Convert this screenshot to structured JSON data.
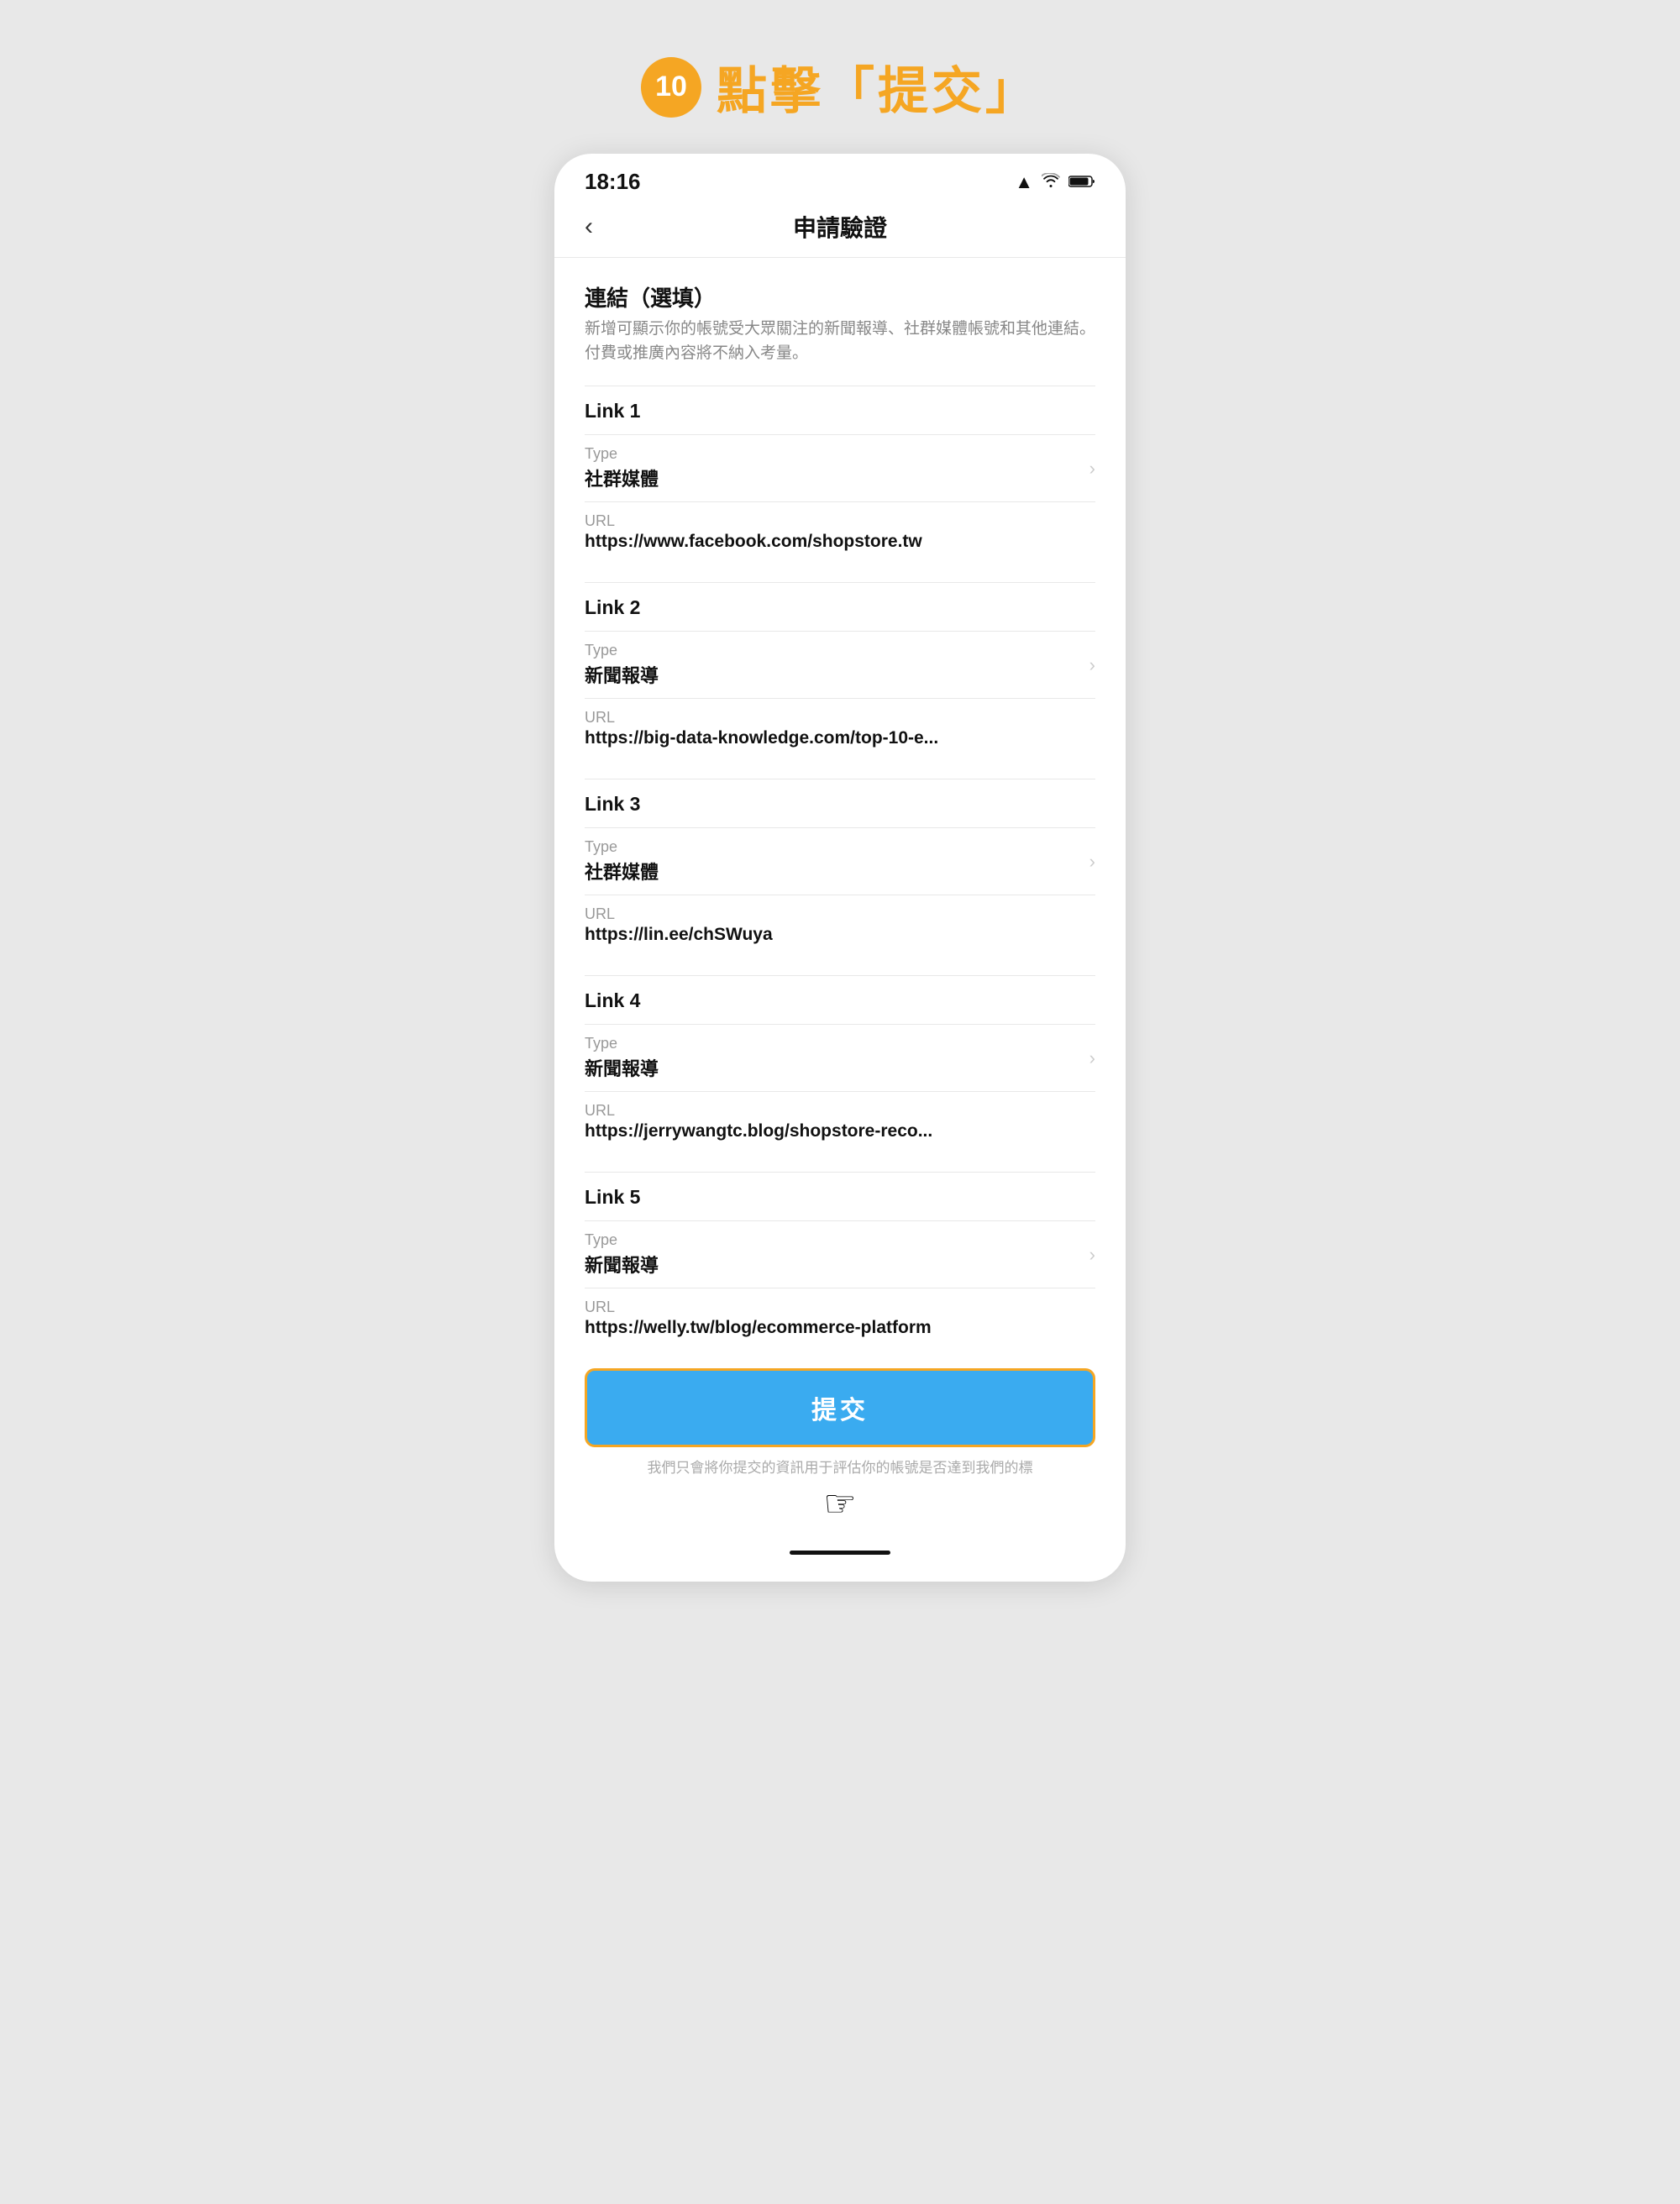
{
  "step": {
    "badge": "10",
    "title": "點擊「提交」"
  },
  "phone": {
    "statusBar": {
      "time": "18:16",
      "signal": "▲",
      "wifi": "WiFi",
      "battery": "🔋"
    },
    "nav": {
      "backLabel": "‹",
      "title": "申請驗證"
    },
    "section": {
      "title": "連結（選填）",
      "description": "新增可顯示你的帳號受大眾關注的新聞報導、社群媒體帳號和其他連結。付費或推廣內容將不納入考量。"
    },
    "links": [
      {
        "label": "Link 1",
        "typeLabel": "Type",
        "typeValue": "社群媒體",
        "urlLabel": "URL",
        "urlValue": "https://www.facebook.com/shopstore.tw"
      },
      {
        "label": "Link 2",
        "typeLabel": "Type",
        "typeValue": "新聞報導",
        "urlLabel": "URL",
        "urlValue": "https://big-data-knowledge.com/top-10-e..."
      },
      {
        "label": "Link 3",
        "typeLabel": "Type",
        "typeValue": "社群媒體",
        "urlLabel": "URL",
        "urlValue": "https://lin.ee/chSWuya"
      },
      {
        "label": "Link 4",
        "typeLabel": "Type",
        "typeValue": "新聞報導",
        "urlLabel": "URL",
        "urlValue": "https://jerrywangtc.blog/shopstore-reco..."
      },
      {
        "label": "Link 5",
        "typeLabel": "Type",
        "typeValue": "新聞報導",
        "urlLabel": "URL",
        "urlValue": "https://welly.tw/blog/ecommerce-platform"
      }
    ],
    "submitButton": "提交",
    "submitNote": "我們只會將你提交的資訊用于評估你的帳號是否達到我們的標",
    "cursorEmoji": "☞"
  }
}
